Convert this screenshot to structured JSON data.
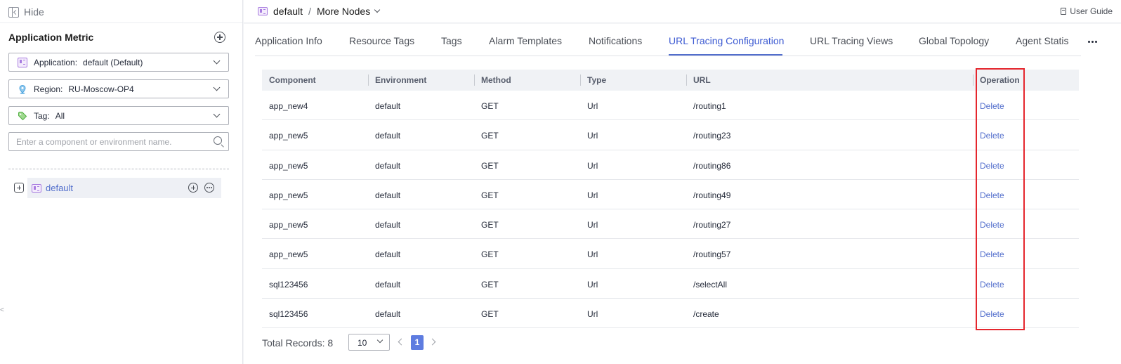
{
  "sidebar": {
    "hide_label": "Hide",
    "title": "Application Metric",
    "application": {
      "label": "Application:",
      "value": "default (Default)"
    },
    "region": {
      "label": "Region:",
      "value": "RU-Moscow-OP4"
    },
    "tag": {
      "label": "Tag:",
      "value": "All"
    },
    "search_placeholder": "Enter a component or environment name.",
    "tree": {
      "node_label": "default"
    }
  },
  "header": {
    "breadcrumb_root": "default",
    "breadcrumb_sep": "/",
    "breadcrumb_more": "More Nodes",
    "user_guide": "User Guide"
  },
  "tabs": [
    "Application Info",
    "Resource Tags",
    "Tags",
    "Alarm Templates",
    "Notifications",
    "URL Tracing Configuration",
    "URL Tracing Views",
    "Global Topology",
    "Agent Statis"
  ],
  "active_tab": "URL Tracing Configuration",
  "table": {
    "columns": [
      "Component",
      "Environment",
      "Method",
      "Type",
      "URL",
      "Operation"
    ],
    "rows": [
      [
        "app_new4",
        "default",
        "GET",
        "Url",
        "/routing1",
        "Delete"
      ],
      [
        "app_new5",
        "default",
        "GET",
        "Url",
        "/routing23",
        "Delete"
      ],
      [
        "app_new5",
        "default",
        "GET",
        "Url",
        "/routing86",
        "Delete"
      ],
      [
        "app_new5",
        "default",
        "GET",
        "Url",
        "/routing49",
        "Delete"
      ],
      [
        "app_new5",
        "default",
        "GET",
        "Url",
        "/routing27",
        "Delete"
      ],
      [
        "app_new5",
        "default",
        "GET",
        "Url",
        "/routing57",
        "Delete"
      ],
      [
        "sql123456",
        "default",
        "GET",
        "Url",
        "/selectAll",
        "Delete"
      ],
      [
        "sql123456",
        "default",
        "GET",
        "Url",
        "/create",
        "Delete"
      ]
    ]
  },
  "pagination": {
    "total_label": "Total Records: 8",
    "page_size": "10",
    "current_page": "1"
  },
  "colors": {
    "accent": "#526ecc",
    "highlight_box": "#e5262d",
    "active_page": "#5e7ce0"
  },
  "icons": {
    "hide": "panel-collapse-icon",
    "add": "add-circle-icon",
    "application": "app-window-icon",
    "region": "location-pin-icon",
    "tag": "tag-icon",
    "search": "search-icon",
    "expand": "plus-square-icon",
    "more": "more-icon",
    "guide": "document-icon"
  }
}
